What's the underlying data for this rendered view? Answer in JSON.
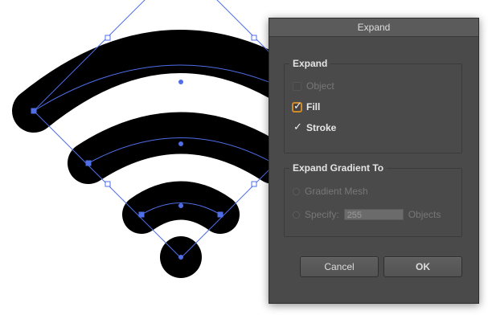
{
  "dialog": {
    "title": "Expand",
    "expand_group": {
      "legend": "Expand",
      "object_label": "Object",
      "object_checked": false,
      "object_enabled": false,
      "fill_label": "Fill",
      "fill_checked": true,
      "stroke_label": "Stroke",
      "stroke_checked": true
    },
    "gradient_group": {
      "legend": "Expand Gradient To",
      "gradient_mesh_label": "Gradient Mesh",
      "specify_label": "Specify:",
      "specify_value": "255",
      "objects_label": "Objects"
    },
    "cancel_label": "Cancel",
    "ok_label": "OK"
  },
  "colors": {
    "artwork_fill": "#000000",
    "selection": "#4f6ee8",
    "dialog_bg": "#4a4a4a",
    "focus_ring": "#d08a2a"
  },
  "icons": {
    "artwork": "wifi-icon"
  }
}
